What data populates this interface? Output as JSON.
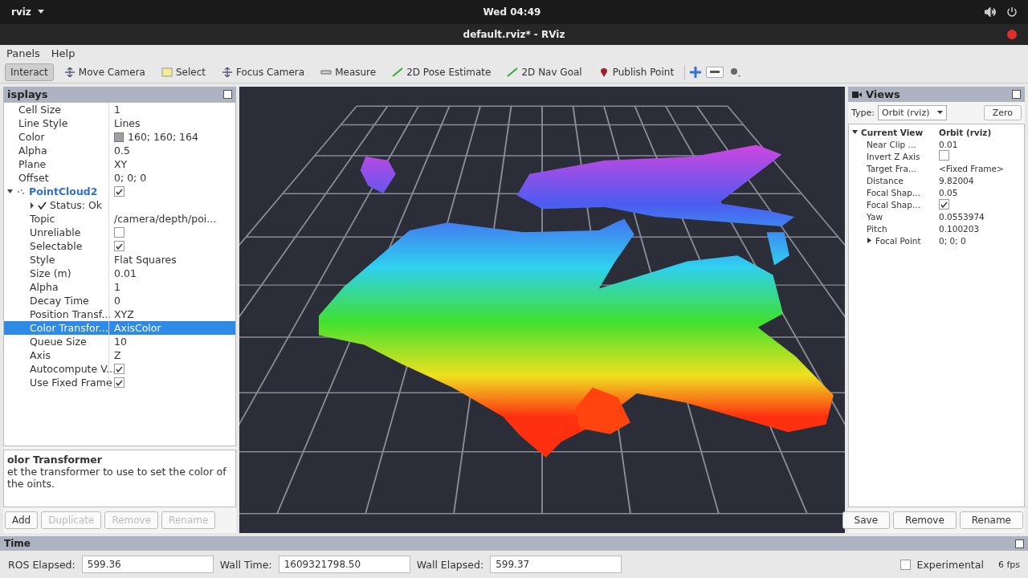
{
  "top_bar": {
    "app_name": "rviz",
    "clock": "Wed 04:49"
  },
  "window": {
    "title": "default.rviz* - RViz"
  },
  "menu": [
    "Panels",
    "Help"
  ],
  "toolbar": [
    {
      "label": "Interact",
      "selected": true
    },
    {
      "label": "Move Camera",
      "selected": false
    },
    {
      "label": "Select",
      "selected": false
    },
    {
      "label": "Focus Camera",
      "selected": false
    },
    {
      "label": "Measure",
      "selected": false
    },
    {
      "label": "2D Pose Estimate",
      "selected": false
    },
    {
      "label": "2D Nav Goal",
      "selected": false
    },
    {
      "label": "Publish Point",
      "selected": false
    }
  ],
  "displays": {
    "title": "isplays",
    "rows": [
      {
        "label": "Cell Size",
        "kind": "text",
        "value": "1",
        "selected": false
      },
      {
        "label": "Line Style",
        "kind": "text",
        "value": "Lines",
        "selected": false
      },
      {
        "label": "Color",
        "kind": "color",
        "value": "160; 160; 164",
        "color": "#a0a0a4",
        "selected": false
      },
      {
        "label": "Alpha",
        "kind": "text",
        "value": "0.5",
        "selected": false
      },
      {
        "label": "Plane",
        "kind": "text",
        "value": "XY",
        "selected": false
      },
      {
        "label": "Offset",
        "kind": "text",
        "value": "0; 0; 0",
        "selected": false
      },
      {
        "label": "PointCloud2",
        "kind": "display",
        "checked": true,
        "expanded": true,
        "selected": false,
        "children": [
          {
            "label": "Status: Ok",
            "kind": "status",
            "expanded": false,
            "selected": false
          },
          {
            "label": "Topic",
            "kind": "text",
            "value": "/camera/depth/poi...",
            "selected": false
          },
          {
            "label": "Unreliable",
            "kind": "check",
            "checked": false,
            "selected": false
          },
          {
            "label": "Selectable",
            "kind": "check",
            "checked": true,
            "selected": false
          },
          {
            "label": "Style",
            "kind": "text",
            "value": "Flat Squares",
            "selected": false
          },
          {
            "label": "Size (m)",
            "kind": "text",
            "value": "0.01",
            "selected": false
          },
          {
            "label": "Alpha",
            "kind": "text",
            "value": "1",
            "selected": false
          },
          {
            "label": "Decay Time",
            "kind": "text",
            "value": "0",
            "selected": false
          },
          {
            "label": "Position Transf...",
            "kind": "text",
            "value": "XYZ",
            "selected": false
          },
          {
            "label": "Color Transfor...",
            "kind": "text",
            "value": "AxisColor",
            "selected": true
          },
          {
            "label": "Queue Size",
            "kind": "text",
            "value": "10",
            "selected": false
          },
          {
            "label": "Axis",
            "kind": "text",
            "value": "Z",
            "selected": false
          },
          {
            "label": "Autocompute V...",
            "kind": "check",
            "checked": true,
            "selected": false
          },
          {
            "label": "Use Fixed Frame",
            "kind": "check",
            "checked": true,
            "selected": false
          }
        ]
      }
    ]
  },
  "description": {
    "title": "olor Transformer",
    "text": "et the transformer to use to set the color of the oints."
  },
  "display_buttons": [
    {
      "label": "Add",
      "disabled": false
    },
    {
      "label": "Duplicate",
      "disabled": true
    },
    {
      "label": "Remove",
      "disabled": true
    },
    {
      "label": "Rename",
      "disabled": true
    }
  ],
  "views": {
    "title": "Views",
    "type_label": "Type:",
    "type_value": "Orbit (rviz)",
    "zero": "Zero",
    "tree": [
      {
        "label": "Current View",
        "kind": "text",
        "value": "Orbit (rviz)",
        "expanded": true,
        "children": [
          {
            "label": "Near Clip ...",
            "kind": "text",
            "value": "0.01"
          },
          {
            "label": "Invert Z Axis",
            "kind": "check",
            "checked": false
          },
          {
            "label": "Target Fra...",
            "kind": "text",
            "value": "<Fixed Frame>"
          },
          {
            "label": "Distance",
            "kind": "text",
            "value": "9.82004"
          },
          {
            "label": "Focal Shap...",
            "kind": "text",
            "value": "0.05"
          },
          {
            "label": "Focal Shap...",
            "kind": "check",
            "checked": true
          },
          {
            "label": "Yaw",
            "kind": "text",
            "value": "0.0553974"
          },
          {
            "label": "Pitch",
            "kind": "text",
            "value": "0.100203"
          },
          {
            "label": "Focal Point",
            "kind": "text",
            "value": "0; 0; 0",
            "expanded": false
          }
        ]
      }
    ],
    "buttons": [
      "Save",
      "Remove",
      "Rename"
    ]
  },
  "time": {
    "title": "Time",
    "fields": [
      {
        "label": "ROS Elapsed:",
        "value": "599.36"
      },
      {
        "label": "Wall Time:",
        "value": "1609321798.50"
      },
      {
        "label": "Wall Elapsed:",
        "value": "599.37"
      }
    ],
    "experimental": {
      "label": "Experimental",
      "checked": false
    },
    "fps": "6 fps"
  }
}
